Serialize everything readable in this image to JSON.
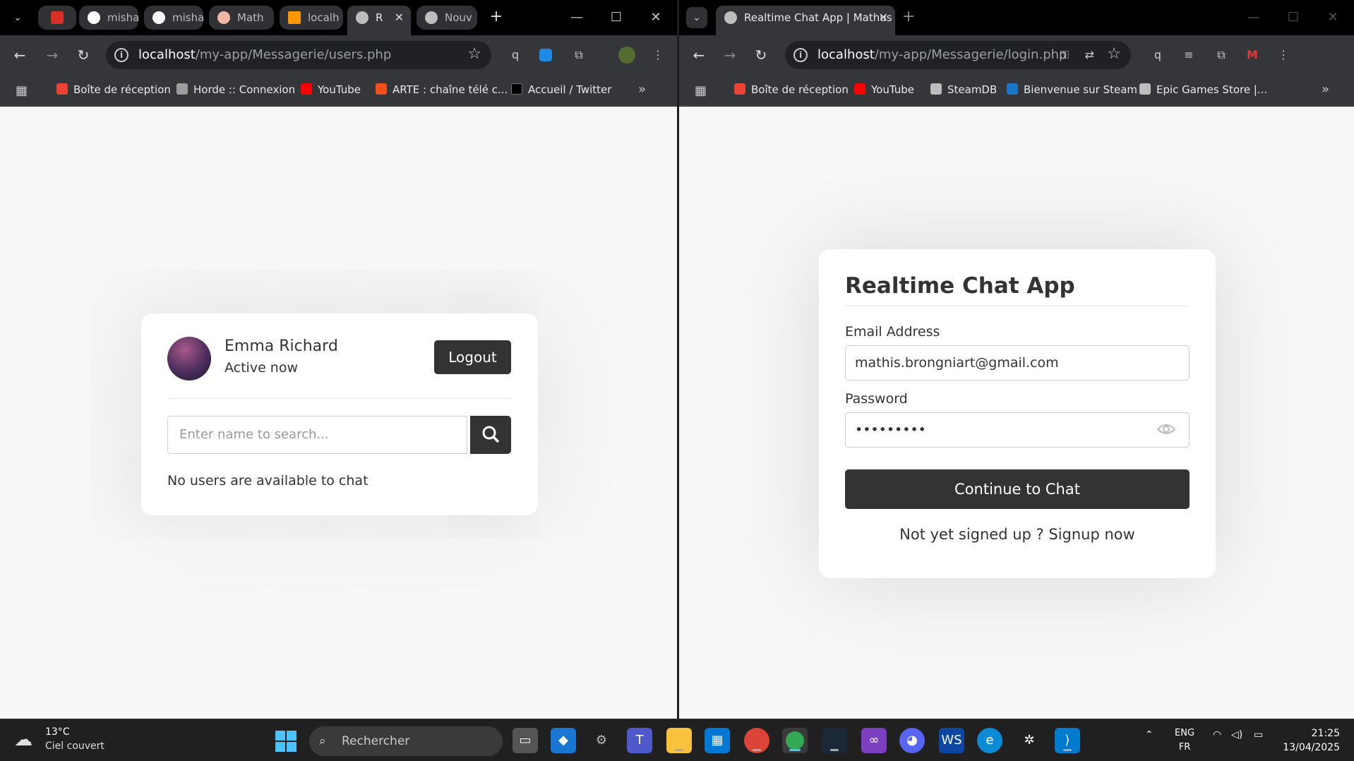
{
  "left_window": {
    "tabs": [
      {
        "label": "",
        "color": "#d93025"
      },
      {
        "label": "misha",
        "color": "#ffffff"
      },
      {
        "label": "misha",
        "color": "#ffffff"
      },
      {
        "label": "Math",
        "color": "#f1b7a5"
      },
      {
        "label": "localh",
        "color": "#ff9800"
      },
      {
        "label": "R",
        "color": "#bdbdbd"
      },
      {
        "label": "Nouv",
        "color": "#bdbdbd"
      }
    ],
    "url_host": "localhost",
    "url_path": "/my-app/Messagerie/users.php",
    "bookmarks": [
      {
        "label": "Boîte de réception",
        "icon": "gmail-icon",
        "color": "#ea4335"
      },
      {
        "label": "Horde :: Connexion",
        "icon": "horde-icon",
        "color": "#9e9e9e"
      },
      {
        "label": "YouTube",
        "icon": "youtube-icon",
        "color": "#ff0000"
      },
      {
        "label": "ARTE : chaîne télé c...",
        "icon": "arte-icon",
        "color": "#f54e1b"
      },
      {
        "label": "Accueil / Twitter",
        "icon": "x-icon",
        "color": "#000000"
      }
    ],
    "page": {
      "user_name": "Emma Richard",
      "user_status": "Active now",
      "logout_label": "Logout",
      "search_placeholder": "Enter name to search...",
      "empty_message": "No users are available to chat"
    }
  },
  "right_window": {
    "tab_title": "Realtime Chat App | Mathus",
    "url_host": "localhost",
    "url_path": "/my-app/Messagerie/login.php",
    "bookmarks": [
      {
        "label": "Boîte de réception",
        "icon": "gmail-icon",
        "color": "#ea4335"
      },
      {
        "label": "YouTube",
        "icon": "youtube-icon",
        "color": "#ff0000"
      },
      {
        "label": "SteamDB",
        "icon": "steamdb-icon",
        "color": "#bdbdbd"
      },
      {
        "label": "Bienvenue sur Steam",
        "icon": "steam-icon",
        "color": "#1b75c9"
      },
      {
        "label": "Epic Games Store |...",
        "icon": "epic-icon",
        "color": "#bdbdbd"
      }
    ],
    "page": {
      "title": "Realtime Chat App",
      "email_label": "Email Address",
      "email_value": "mathis.brongniart@gmail.com",
      "password_label": "Password",
      "password_value": "•••••••••",
      "continue_label": "Continue to Chat",
      "signup_prompt": "Not yet signed up ?",
      "signup_link": "Signup now"
    }
  },
  "taskbar": {
    "temperature": "13°C",
    "condition": "Ciel couvert",
    "search_label": "Rechercher",
    "lang_1": "ENG",
    "lang_2": "FR",
    "time": "21:25",
    "date": "13/04/2025"
  }
}
